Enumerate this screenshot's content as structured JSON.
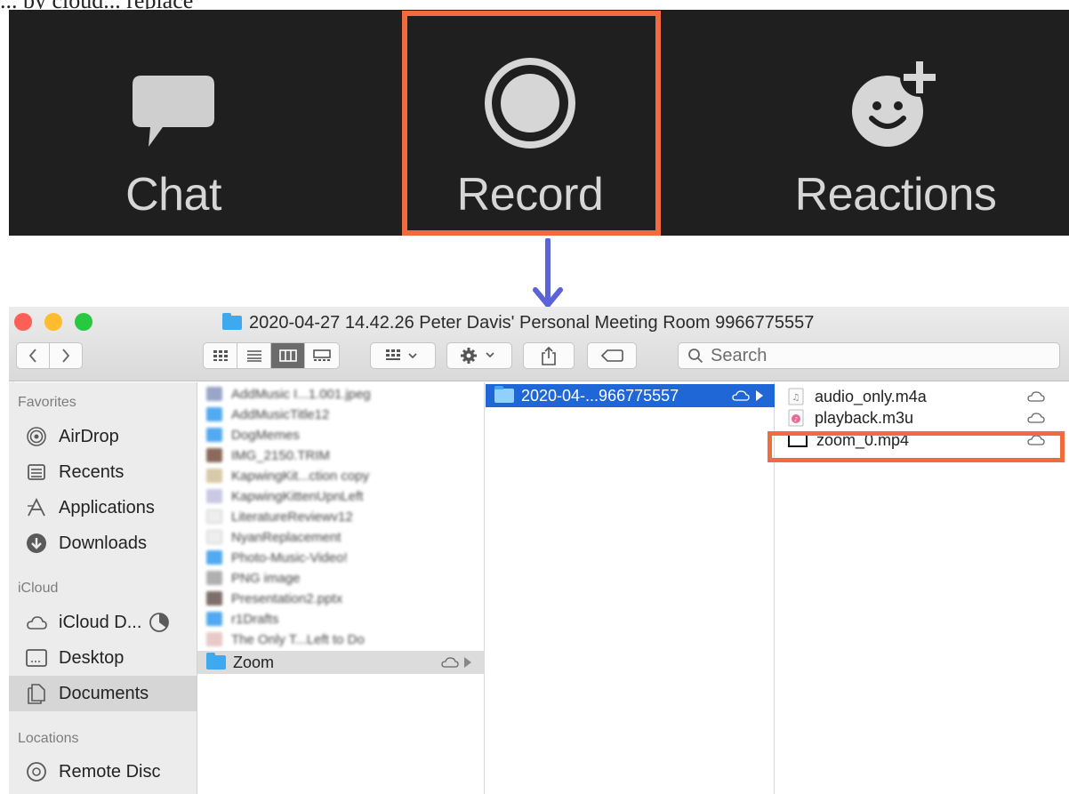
{
  "caption": "... by cloud... replace",
  "zoom_toolbar": {
    "chat_label": "Chat",
    "record_label": "Record",
    "reactions_label": "Reactions",
    "icons": [
      "chat-bubble-icon",
      "record-icon",
      "reactions-icon"
    ],
    "highlight_color": "#f26b3f"
  },
  "arrow_color": "#5b63d9",
  "finder": {
    "title": "2020-04-27 14.42.26 Peter Davis' Personal Meeting Room 9966775557",
    "search_placeholder": "Search",
    "sidebar": {
      "favorites_heading": "Favorites",
      "icloud_heading": "iCloud",
      "locations_heading": "Locations",
      "favorites": [
        {
          "label": "AirDrop",
          "icon": "airdrop-icon"
        },
        {
          "label": "Recents",
          "icon": "recents-icon"
        },
        {
          "label": "Applications",
          "icon": "applications-icon"
        },
        {
          "label": "Downloads",
          "icon": "downloads-icon"
        }
      ],
      "icloud": [
        {
          "label": "iCloud D...",
          "icon": "icloud-icon"
        },
        {
          "label": "Desktop",
          "icon": "desktop-icon"
        },
        {
          "label": "Documents",
          "icon": "documents-icon",
          "selected": true
        }
      ],
      "locations": [
        {
          "label": "Remote Disc",
          "icon": "remote-disc-icon"
        }
      ]
    },
    "column1": {
      "blurred_items": [
        "AddMusic I...1.001.jpeg",
        "AddMusicTitle12",
        "DogMemes",
        "IMG_2150.TRIM",
        "KapwingKit...ction copy",
        "KapwingKittenUpnLeft",
        "LiteratureReviewv12",
        "NyanReplacement",
        "Photo-Music-Video!",
        "PNG image",
        "Presentation2.pptx",
        "r1Drafts",
        "The Only T...Left to Do"
      ],
      "zoom_folder": "Zoom"
    },
    "column2": {
      "folder": "2020-04-...966775557"
    },
    "column3": {
      "files": [
        {
          "name": "audio_only.m4a",
          "icon": "audio-file-icon"
        },
        {
          "name": "playback.m3u",
          "icon": "playlist-file-icon"
        },
        {
          "name": "zoom_0.mp4",
          "icon": "video-file-icon"
        }
      ]
    }
  }
}
